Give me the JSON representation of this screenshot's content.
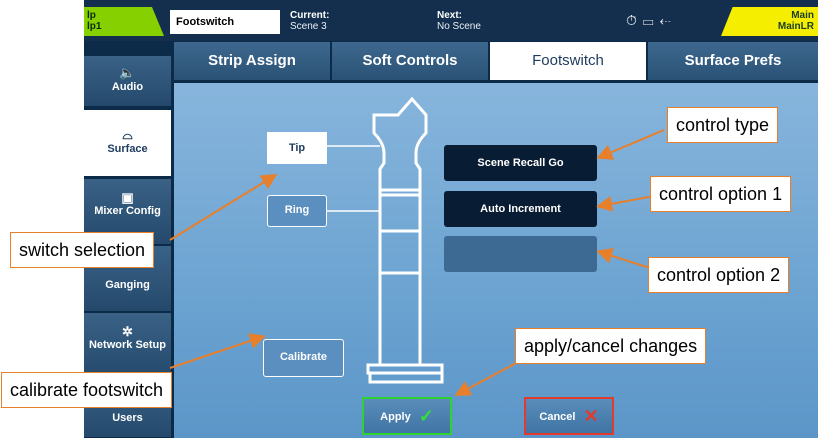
{
  "topbar": {
    "lp_line1": "lp",
    "lp_line2": "lp1",
    "screen_tab": "Footswitch",
    "current_label": "Current:",
    "current_value": "Scene 3",
    "next_label": "Next:",
    "next_value": "No Scene",
    "main_line1": "Main",
    "main_line2": "MainLR"
  },
  "sidebar": {
    "items": [
      {
        "label": "Audio",
        "icon": "speaker-icon"
      },
      {
        "label": "Surface",
        "icon": "surface-icon"
      },
      {
        "label": "Mixer Config",
        "icon": "mixer-config-icon"
      },
      {
        "label": "Ganging",
        "icon": "ganging-icon"
      },
      {
        "label": "Network Setup",
        "icon": "network-icon"
      },
      {
        "label": "Users",
        "icon": "users-icon"
      }
    ]
  },
  "tabs": [
    "Strip Assign",
    "Soft Controls",
    "Footswitch",
    "Surface Prefs"
  ],
  "footswitch": {
    "tip_label": "Tip",
    "ring_label": "Ring",
    "calibrate_label": "Calibrate",
    "control_type_value": "Scene Recall Go",
    "control_option1_value": "Auto Increment",
    "control_option2_value": "",
    "apply_label": "Apply",
    "cancel_label": "Cancel"
  },
  "callouts": {
    "control_type": "control type",
    "control_option1": "control option 1",
    "control_option2": "control option 2",
    "switch_selection": "switch selection",
    "calibrate_footswitch": "calibrate footswitch",
    "apply_cancel": "apply/cancel changes"
  },
  "colors": {
    "background": "#0c2b49",
    "panel": "#74a8d4",
    "lp_green": "#86d000",
    "main_yellow": "#f5ee00",
    "callout_border": "#e87f2a",
    "apply_green": "#2fd233",
    "cancel_red": "#e23b2e"
  }
}
